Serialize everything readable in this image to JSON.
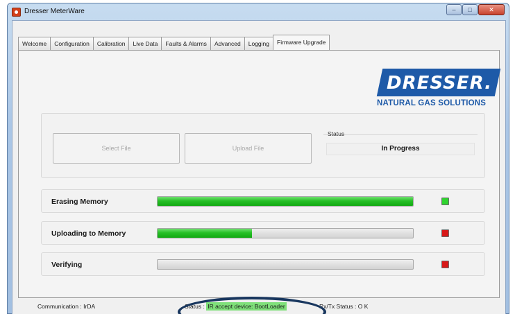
{
  "window": {
    "title": "Dresser MeterWare",
    "center_title": "",
    "controls": [
      "–",
      "□",
      "✕"
    ]
  },
  "tabs": [
    {
      "label": "Welcome",
      "active": false
    },
    {
      "label": "Configuration",
      "active": false
    },
    {
      "label": "Calibration",
      "active": false
    },
    {
      "label": "Live Data",
      "active": false
    },
    {
      "label": "Faults & Alarms",
      "active": false
    },
    {
      "label": "Advanced",
      "active": false
    },
    {
      "label": "Logging",
      "active": false
    },
    {
      "label": "Firmware Upgrade",
      "active": true
    }
  ],
  "logo": {
    "brand": "DRESSER.",
    "subtitle": "NATURAL GAS SOLUTIONS",
    "color": "#1e5aa8"
  },
  "firmware": {
    "select_file_label": "Select File",
    "upload_file_label": "Upload File",
    "status_label": "Status",
    "status_value": "In Progress"
  },
  "progress": [
    {
      "label": "Erasing Memory",
      "fraction": 1.0,
      "indicator_color": "#2fd42f"
    },
    {
      "label": "Uploading to Memory",
      "fraction": 0.37,
      "indicator_color": "#d81818"
    },
    {
      "label": "Verifying",
      "fraction": 0.0,
      "indicator_color": "#d81818"
    }
  ],
  "statusbar": {
    "communication": "Communication : IrDA",
    "status_prefix": "Status :",
    "status_value": "IR accept device: BootLoader",
    "rxtx": "Rx/Tx Status : O K"
  }
}
